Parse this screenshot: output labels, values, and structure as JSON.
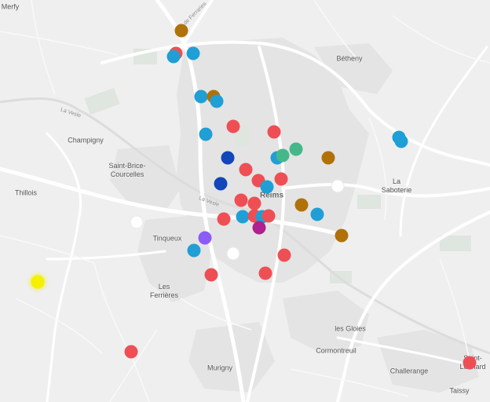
{
  "labels": {
    "merfy": "Merfy",
    "betheny": "Bétheny",
    "champigny": "Champigny",
    "saint_brice_1": "Saint-Brice-",
    "saint_brice_2": "Courcelles",
    "thillois": "Thillois",
    "reims": "Reims",
    "la_saboterie_1": "La",
    "la_saboterie_2": "Saboterie",
    "tinqueux": "Tinqueux",
    "les_ferrieres_1": "Les",
    "les_ferrieres_2": "Ferrières",
    "les_gloies": "les Gloies",
    "cormontreuil": "Cormontreuil",
    "murigny": "Murigny",
    "challerange": "Challerange",
    "saint_leonard_1": "Saint-",
    "saint_leonard_2": "Léonard",
    "taissy": "Taissy",
    "la_vesle": "La Vesle",
    "ch_ferraries": "Ch. de Ferraries",
    "la_vesle_west": "La Vesle"
  },
  "colors": {
    "red": "#ee4f55",
    "blue": "#1f9fd5",
    "brown": "#b07208",
    "green": "#45b88a",
    "navy": "#1346b8",
    "purple": "#8b5cf6",
    "magenta": "#b0208e",
    "white": "#ffffff",
    "yellow": "#f4f000"
  },
  "markers": [
    {
      "color": "brown"
    },
    {
      "color": "blue"
    },
    {
      "color": "red"
    },
    {
      "color": "blue"
    },
    {
      "color": "blue"
    },
    {
      "color": "brown"
    },
    {
      "color": "blue"
    },
    {
      "color": "red"
    },
    {
      "color": "red"
    },
    {
      "color": "blue"
    },
    {
      "color": "navy"
    },
    {
      "color": "red"
    },
    {
      "color": "green"
    },
    {
      "color": "blue"
    },
    {
      "color": "green"
    },
    {
      "color": "brown"
    },
    {
      "color": "red"
    },
    {
      "color": "navy"
    },
    {
      "color": "red"
    },
    {
      "color": "blue"
    },
    {
      "color": "white"
    },
    {
      "color": "red"
    },
    {
      "color": "red"
    },
    {
      "color": "brown"
    },
    {
      "color": "blue"
    },
    {
      "color": "red"
    },
    {
      "color": "blue"
    },
    {
      "color": "red"
    },
    {
      "color": "blue"
    },
    {
      "color": "red"
    },
    {
      "color": "magenta"
    },
    {
      "color": "white"
    },
    {
      "color": "brown"
    },
    {
      "color": "purple"
    },
    {
      "color": "blue"
    },
    {
      "color": "white"
    },
    {
      "color": "red"
    },
    {
      "color": "red"
    },
    {
      "color": "red"
    },
    {
      "color": "yellow"
    },
    {
      "color": "red"
    },
    {
      "color": "red"
    },
    {
      "color": "blue"
    },
    {
      "color": "blue"
    }
  ]
}
